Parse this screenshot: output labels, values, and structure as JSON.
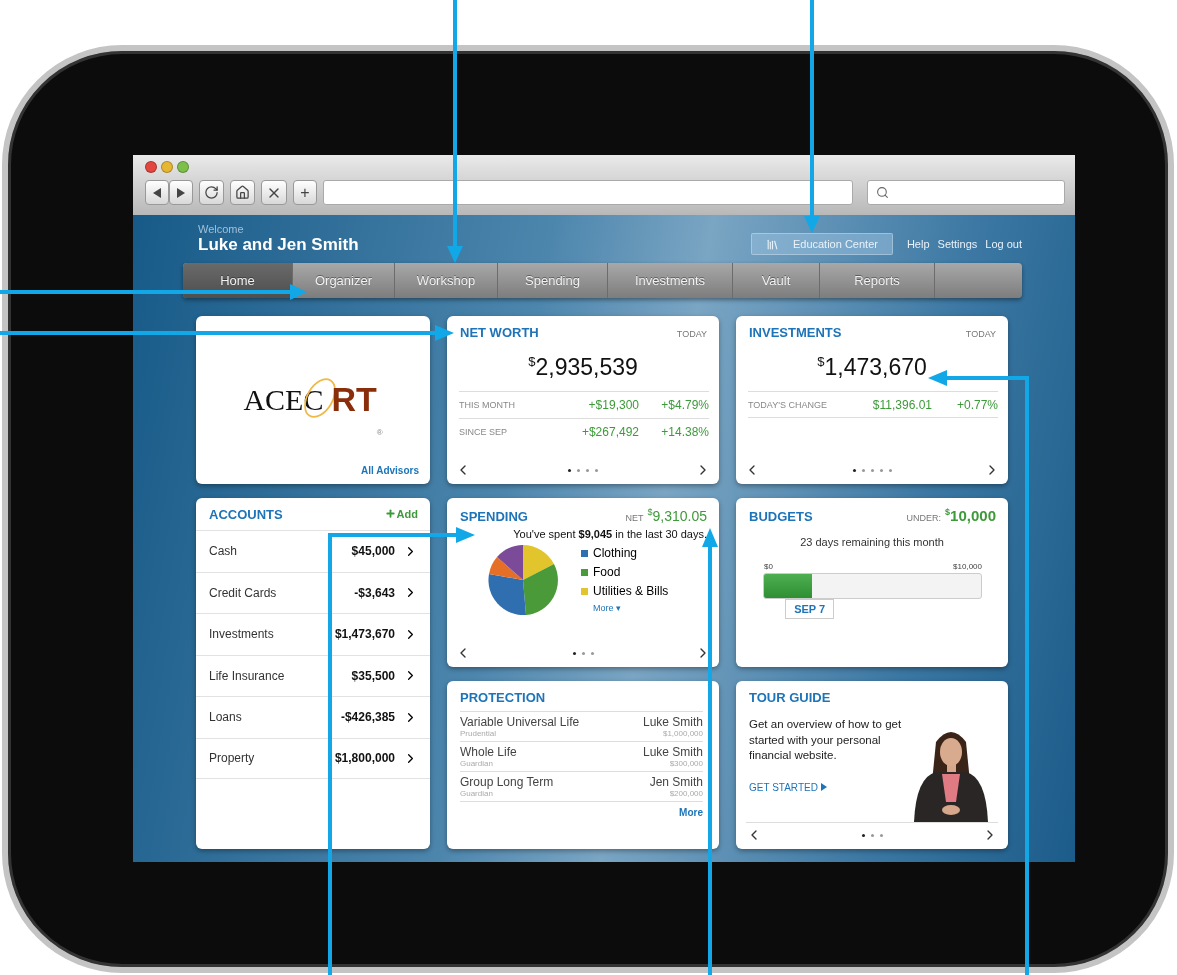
{
  "browser": {
    "new_tab": "+"
  },
  "header": {
    "welcome": "Welcome",
    "name": "Luke and Jen Smith",
    "education_button": "Education Center",
    "links": [
      "Help",
      "Settings",
      "Log out"
    ]
  },
  "nav": [
    {
      "label": "Home",
      "selected": true
    },
    {
      "label": "Organizer",
      "selected": false
    },
    {
      "label": "Workshop",
      "selected": false
    },
    {
      "label": "Spending",
      "selected": false
    },
    {
      "label": "Investments",
      "selected": false
    },
    {
      "label": "Vault",
      "selected": false
    },
    {
      "label": "Reports",
      "selected": false
    }
  ],
  "advisor": {
    "logo_left": "ACEC",
    "logo_right": "RT",
    "logo_mark": "®",
    "link": "All Advisors"
  },
  "net_worth": {
    "title": "NET WORTH",
    "period": "TODAY",
    "currency": "$",
    "value": "2,935,539",
    "rows": [
      {
        "label": "THIS MONTH",
        "amount": "+$19,300",
        "percent": "+$4.79%"
      },
      {
        "label": "SINCE SEP",
        "amount": "+$267,492",
        "percent": "+14.38%"
      }
    ],
    "pager": [
      {
        "selected": true
      },
      {
        "selected": false
      },
      {
        "selected": false
      },
      {
        "selected": false
      }
    ]
  },
  "investments": {
    "title": "INVESTMENTS",
    "period": "TODAY",
    "currency": "$",
    "value": "1,473,670",
    "rows": [
      {
        "label": "TODAY'S CHANGE",
        "amount": "$11,396.01",
        "percent": "+0.77%"
      }
    ],
    "pager": [
      {
        "selected": true
      },
      {
        "selected": false
      },
      {
        "selected": false
      },
      {
        "selected": false
      },
      {
        "selected": false
      }
    ]
  },
  "accounts": {
    "title": "ACCOUNTS",
    "add": "Add",
    "rows": [
      {
        "name": "Cash",
        "amount": "$45,000"
      },
      {
        "name": "Credit Cards",
        "amount": "-$3,643"
      },
      {
        "name": "Investments",
        "amount": "$1,473,670"
      },
      {
        "name": "Life Insurance",
        "amount": "$35,500"
      },
      {
        "name": "Loans",
        "amount": "-$426,385"
      },
      {
        "name": "Property",
        "amount": "$1,800,000"
      }
    ]
  },
  "spending": {
    "title": "SPENDING",
    "net_label": "NET",
    "currency": "$",
    "value": "9,310.05",
    "summary": "You've spent **$9,045** in the last 30 days.",
    "legend": [
      {
        "label": "Clothing",
        "color": "#2f6fb0"
      },
      {
        "label": "Food",
        "color": "#4a9a3a"
      },
      {
        "label": "Utilities & Bills",
        "color": "#e2c52c"
      }
    ],
    "more": "More",
    "more_caret": "▾",
    "pager": [
      {
        "selected": true
      },
      {
        "selected": false
      },
      {
        "selected": false
      }
    ]
  },
  "budgets": {
    "title": "BUDGETS",
    "under_label": "UNDER:",
    "currency": "$",
    "value": "10,000",
    "remaining": "23 days remaining this month",
    "min": "$0",
    "max": "$10,000",
    "level": 0.22,
    "marker": "SEP 7"
  },
  "protection": {
    "title": "PROTECTION",
    "policies": [
      {
        "name": "Variable Universal Life",
        "insurer": "Prudential",
        "owner": "Luke Smith",
        "amount": "$1,000,000"
      },
      {
        "name": "Whole Life",
        "insurer": "Guardian",
        "owner": "Luke Smith",
        "amount": "$300,000"
      },
      {
        "name": "Group Long Term",
        "insurer": "Guardian",
        "owner": "Jen Smith",
        "amount": "$200,000"
      }
    ],
    "more": "More"
  },
  "tour": {
    "title": "TOUR GUIDE",
    "text": "Get an overview of how to get started with your personal financial website.",
    "cta": "GET STARTED",
    "pager": [
      {
        "selected": true
      },
      {
        "selected": false
      },
      {
        "selected": false
      }
    ]
  }
}
